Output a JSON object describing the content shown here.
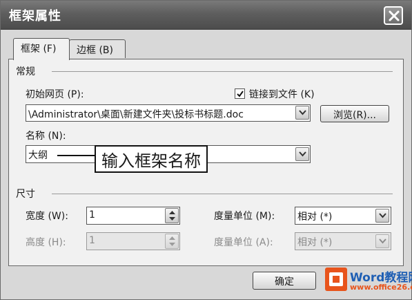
{
  "window": {
    "title": "框架属性"
  },
  "tabs": [
    {
      "label": "框架 (F)"
    },
    {
      "label": "边框 (B)"
    }
  ],
  "general": {
    "section_label": "常规",
    "initial_page": {
      "label": "初始网页 (P):",
      "value": "\\Administrator\\桌面\\新建文件夹\\投标书标题.doc",
      "browse_label": "浏览(R)..."
    },
    "link_to_file": {
      "label": "链接到文件 (K)",
      "checked": true
    },
    "name": {
      "label": "名称 (N):",
      "value": "大纲"
    }
  },
  "callout": {
    "text": "输入框架名称"
  },
  "size": {
    "section_label": "尺寸",
    "width": {
      "label": "宽度 (W):",
      "value": "1",
      "unit_label": "度量单位 (M):",
      "unit_value": "相对 (*)"
    },
    "height": {
      "label": "高度 (H):",
      "value": "1",
      "unit_label": "度量单位 (A):",
      "unit_value": "相对 (*)",
      "disabled": true
    }
  },
  "buttons": {
    "ok_label": "确定"
  },
  "watermark": {
    "line1": "Word教程网",
    "line2": "www.office26.com"
  },
  "colors": {
    "titlebar": "#5e5e5e",
    "dialog_bg": "#d8d8d8",
    "panel_bg": "#f1f1f1",
    "watermark_orange": "#e8541c",
    "watermark_blue": "#1f5fb4"
  },
  "icons": {
    "close": "close-icon",
    "check": "check-icon",
    "dropdown": "chevron-down-icon",
    "spinner": "spinner-arrows-icon",
    "logo": "office-logo-icon"
  }
}
